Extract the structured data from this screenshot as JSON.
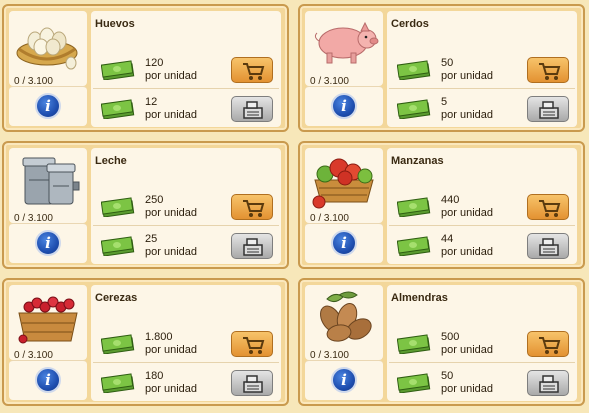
{
  "products": [
    {
      "name": "Huevos",
      "stock": "0 / 3.100",
      "buy_price": "120",
      "sell_price": "12",
      "unit": "por unidad",
      "icon": "egg-basket-icon"
    },
    {
      "name": "Cerdos",
      "stock": "0 / 3.100",
      "buy_price": "50",
      "sell_price": "5",
      "unit": "por unidad",
      "icon": "pig-icon"
    },
    {
      "name": "Leche",
      "stock": "0 / 3.100",
      "buy_price": "250",
      "sell_price": "25",
      "unit": "por unidad",
      "icon": "milk-can-icon"
    },
    {
      "name": "Manzanas",
      "stock": "0 / 3.100",
      "buy_price": "440",
      "sell_price": "44",
      "unit": "por unidad",
      "icon": "apple-basket-icon"
    },
    {
      "name": "Cerezas",
      "stock": "0 / 3.100",
      "buy_price": "1.800",
      "sell_price": "180",
      "unit": "por unidad",
      "icon": "cherry-crate-icon"
    },
    {
      "name": "Almendras",
      "stock": "0 / 3.100",
      "buy_price": "500",
      "sell_price": "50",
      "unit": "por unidad",
      "icon": "almonds-icon"
    }
  ],
  "info_label": "i",
  "colors": {
    "background": "#f7e7b9",
    "card": "#f3d79a",
    "buy_button": "#e39232",
    "sell_button": "#a9a9a9",
    "info_button": "#1f4fb0"
  }
}
